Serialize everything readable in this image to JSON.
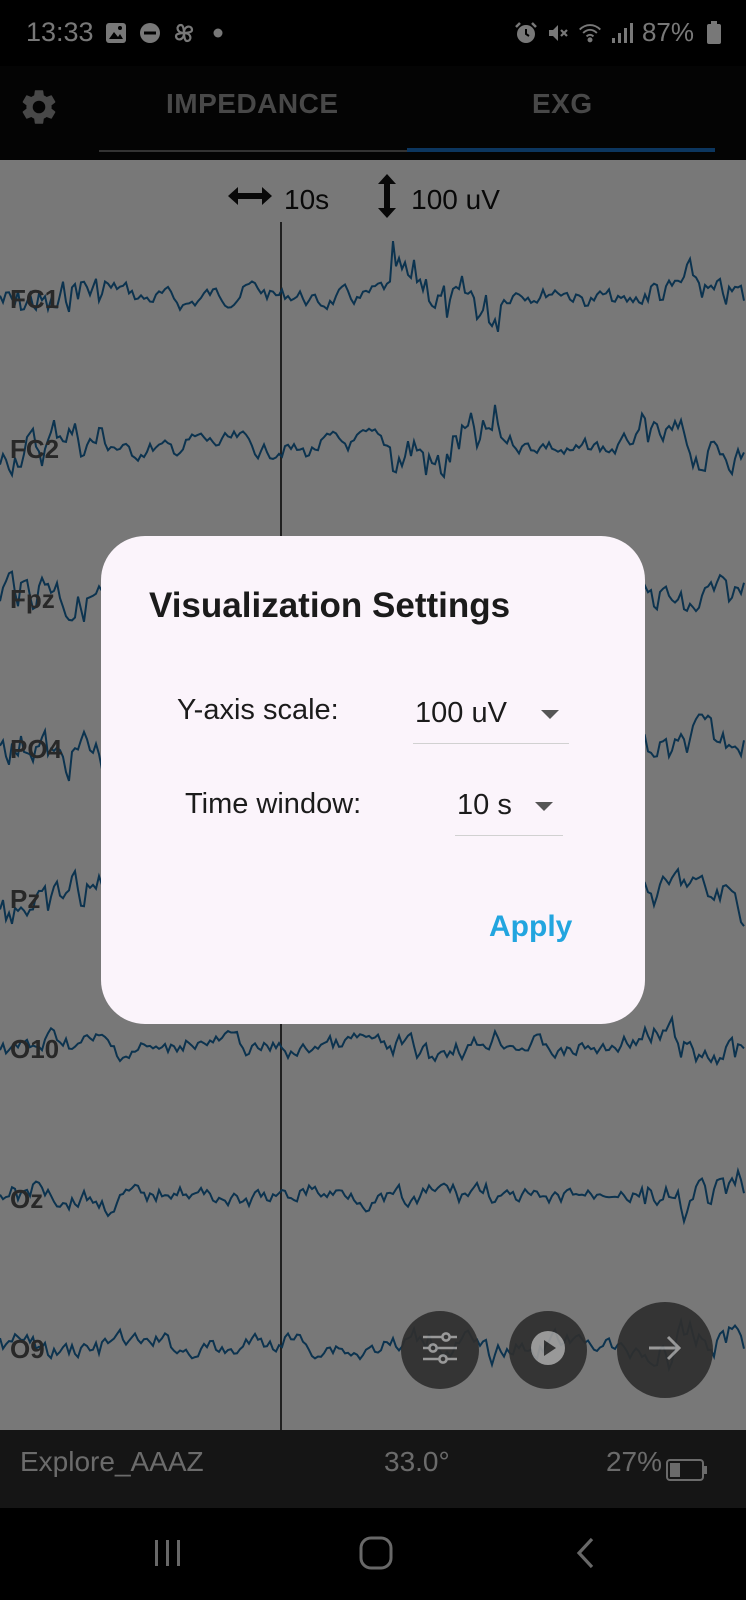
{
  "status_bar": {
    "time": "13:33",
    "battery_percent": "87%",
    "left_icons": [
      "image-icon",
      "do-not-disturb-icon",
      "pinwheel-icon",
      "dot-icon"
    ],
    "right_icons": [
      "alarm-icon",
      "mute-icon",
      "wifi-icon",
      "signal-icon",
      "battery-icon"
    ]
  },
  "header": {
    "settings_icon": "gear-icon",
    "tabs": [
      {
        "label": "IMPEDANCE",
        "active": false
      },
      {
        "label": "EXG",
        "active": true
      }
    ]
  },
  "plot": {
    "time_scale": "10s",
    "amplitude_scale": "100 uV",
    "channels": [
      "FC1",
      "FC2",
      "Fpz",
      "PO4",
      "Pz",
      "O10",
      "Oz",
      "O9"
    ],
    "trace_color": "#1a6ea8"
  },
  "info_bar": {
    "device_name": "Explore_AAAZ",
    "temperature": "33.0°",
    "battery": "27%"
  },
  "fabs": [
    "sliders-icon",
    "play-icon",
    "arrow-right-icon"
  ],
  "nav_bar": [
    "recent-apps-icon",
    "home-icon",
    "back-icon"
  ],
  "dialog": {
    "title": "Visualization Settings",
    "y_axis_label": "Y-axis scale:",
    "y_axis_value": "100 uV",
    "time_window_label": "Time window:",
    "time_window_value": "10 s",
    "apply_label": "Apply",
    "accent_color": "#22a5df"
  }
}
